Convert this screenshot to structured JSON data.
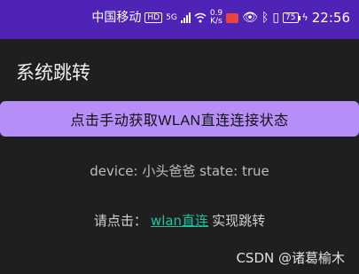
{
  "status_bar": {
    "carrier": "中国移动",
    "hd_badge": "HD",
    "network": "5G",
    "speed_value": "0.9",
    "speed_unit": "K/s",
    "battery": "75",
    "time": "22:56",
    "icons": [
      "hd-icon",
      "signal-icon",
      "wifi-icon",
      "notification-icon",
      "eye-icon",
      "bluetooth-icon",
      "vibrate-icon",
      "battery-icon",
      "charging-icon"
    ]
  },
  "app_bar": {
    "title": "系统跳转"
  },
  "main": {
    "button_label": "点击手动获取WLAN直连连接状态",
    "device_status": "device: 小头爸爸 state: true",
    "instruction_prefix": "请点击：",
    "instruction_link": "wlan直连",
    "instruction_suffix": "实现跳转"
  },
  "watermark": "CSDN @诸葛榆木",
  "colors": {
    "status_bar": "#4f23b5",
    "background": "#1f1f1f",
    "button": "#b58ef7",
    "link": "#19c4a2"
  }
}
